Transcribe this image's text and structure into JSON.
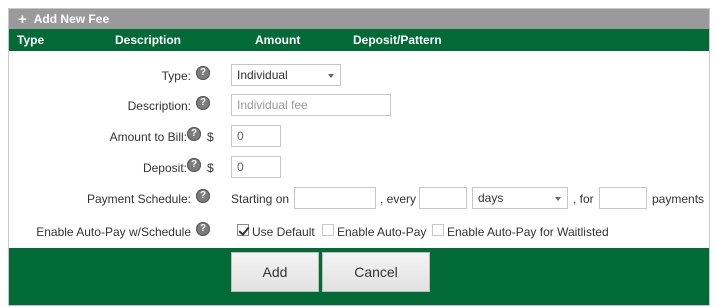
{
  "panel": {
    "title": "Add New Fee"
  },
  "table_header": {
    "columns": [
      "Type",
      "Description",
      "Amount",
      "Deposit/Pattern"
    ]
  },
  "form": {
    "type": {
      "label": "Type:",
      "value": "Individual"
    },
    "description": {
      "label": "Description:",
      "placeholder": "Individual fee"
    },
    "amount": {
      "label": "Amount to Bill:",
      "currency": "$",
      "value": "0"
    },
    "deposit": {
      "label": "Deposit:",
      "currency": "$",
      "value": "0"
    },
    "payment_schedule": {
      "label": "Payment Schedule:",
      "starting_on": "Starting on",
      "every": ", every",
      "period": "days",
      "for": ", for",
      "payments": "payments"
    },
    "auto_pay": {
      "label": "Enable Auto-Pay w/Schedule",
      "options": [
        {
          "label": "Use Default",
          "checked": true
        },
        {
          "label": "Enable Auto-Pay",
          "checked": false
        },
        {
          "label": "Enable Auto-Pay for Waitlisted",
          "checked": false
        }
      ]
    }
  },
  "buttons": {
    "add": "Add",
    "cancel": "Cancel"
  },
  "colors": {
    "header_green": "#026a36",
    "title_gray": "#9a9a9a"
  }
}
